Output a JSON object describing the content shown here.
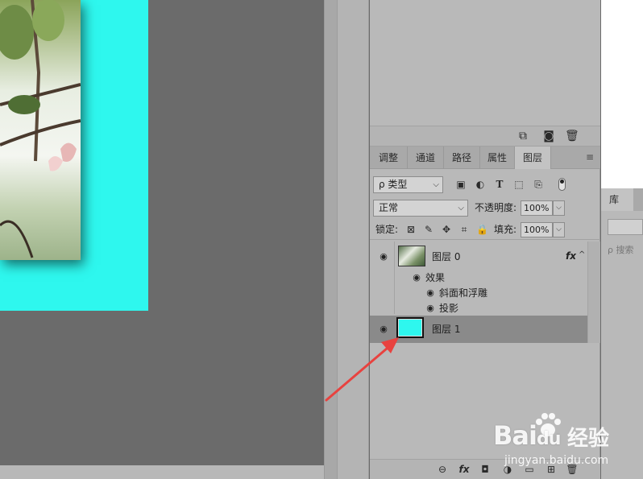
{
  "top_toolbar": {
    "icons": [
      "new-snapshot-icon",
      "camera-icon",
      "trash-icon"
    ]
  },
  "tabs": [
    {
      "label": "调整"
    },
    {
      "label": "通道"
    },
    {
      "label": "路径"
    },
    {
      "label": "属性"
    },
    {
      "label": "图层"
    }
  ],
  "active_tab": "图层",
  "filter": {
    "kind_label": "ρ 类型",
    "icons": [
      "image-filter-icon",
      "adjustment-filter-icon",
      "type-filter-icon",
      "shape-filter-icon",
      "smart-object-filter-icon"
    ]
  },
  "blend": {
    "mode": "正常",
    "opacity_label": "不透明度:",
    "opacity_value": "100%"
  },
  "lock": {
    "label": "锁定:",
    "icons": [
      "lock-transparent-icon",
      "lock-paint-icon",
      "lock-move-icon",
      "lock-artboard-icon",
      "lock-all-icon"
    ],
    "fill_label": "填充:",
    "fill_value": "100%"
  },
  "layers": [
    {
      "name": "图层 0",
      "fx": "fx",
      "effects_label": "效果",
      "effects": [
        "斜面和浮雕",
        "投影"
      ],
      "selected": false
    },
    {
      "name": "图层 1",
      "selected": true,
      "thumb_color": "#2ef7ee"
    }
  ],
  "bottom_toolbar": {
    "icons": [
      "link-icon",
      "fx-icon",
      "mask-icon",
      "adjustment-layer-icon",
      "folder-icon",
      "new-layer-icon",
      "trash-icon"
    ],
    "fx_label": "fx"
  },
  "library": {
    "tab_label": "库",
    "search_placeholder": "ρ 搜索"
  },
  "watermark": {
    "logo": "Bai",
    "logo_suffix": "du",
    "cn": "经验",
    "url": "jingyan.baidu.com"
  },
  "colors": {
    "canvas_layer": "#2ef7ee",
    "annotation_arrow": "#e8423f",
    "selected_layer_bg": "#8a8a8a"
  }
}
